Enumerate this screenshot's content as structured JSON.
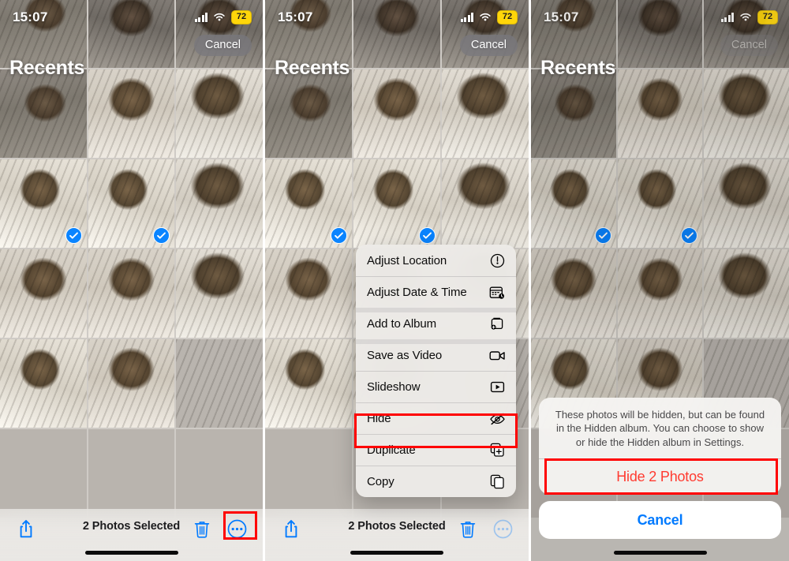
{
  "annotation": {
    "color": "#ff0000"
  },
  "panels": [
    {
      "id": "panel-select",
      "status": {
        "time": "15:07",
        "battery": "72",
        "signal_icon": "cellular-bars-icon",
        "wifi_icon": "wifi-icon",
        "battery_icon": "battery-low-power-icon"
      },
      "cancel_label": "Cancel",
      "title": "Recents",
      "toolbar": {
        "share_icon": "share-icon",
        "count_label": "2 Photos Selected",
        "trash_icon": "trash-icon",
        "more_icon": "more-ellipsis-icon"
      }
    },
    {
      "id": "panel-menu",
      "status": {
        "time": "15:07",
        "battery": "72",
        "signal_icon": "cellular-bars-icon",
        "wifi_icon": "wifi-icon",
        "battery_icon": "battery-low-power-icon"
      },
      "cancel_label": "Cancel",
      "title": "Recents",
      "toolbar": {
        "share_icon": "share-icon",
        "count_label": "2 Photos Selected",
        "trash_icon": "trash-icon",
        "more_icon": "more-ellipsis-icon"
      },
      "context_menu": {
        "items": [
          {
            "label": "Adjust Location",
            "icon": "location-clock-icon",
            "highlighted": false
          },
          {
            "label": "Adjust Date & Time",
            "icon": "calendar-clock-icon",
            "highlighted": false
          },
          {
            "label": "Add to Album",
            "icon": "add-to-album-icon",
            "highlighted": false
          },
          {
            "label": "Save as Video",
            "icon": "video-camera-icon",
            "highlighted": false
          },
          {
            "label": "Slideshow",
            "icon": "play-box-icon",
            "highlighted": false
          },
          {
            "label": "Hide",
            "icon": "eye-slash-icon",
            "highlighted": true
          },
          {
            "label": "Duplicate",
            "icon": "duplicate-icon",
            "highlighted": false
          },
          {
            "label": "Copy",
            "icon": "copy-icon",
            "highlighted": false
          }
        ]
      }
    },
    {
      "id": "panel-confirm",
      "status": {
        "time": "15:07",
        "battery": "72",
        "signal_icon": "cellular-bars-icon",
        "wifi_icon": "wifi-icon",
        "battery_icon": "battery-low-power-icon"
      },
      "cancel_label": "Cancel",
      "title": "Recents",
      "action_sheet": {
        "message": "These photos will be hidden, but can be found in the Hidden album. You can choose to show or hide the Hidden album in Settings.",
        "destructive_label": "Hide 2 Photos",
        "cancel_label": "Cancel"
      }
    }
  ]
}
